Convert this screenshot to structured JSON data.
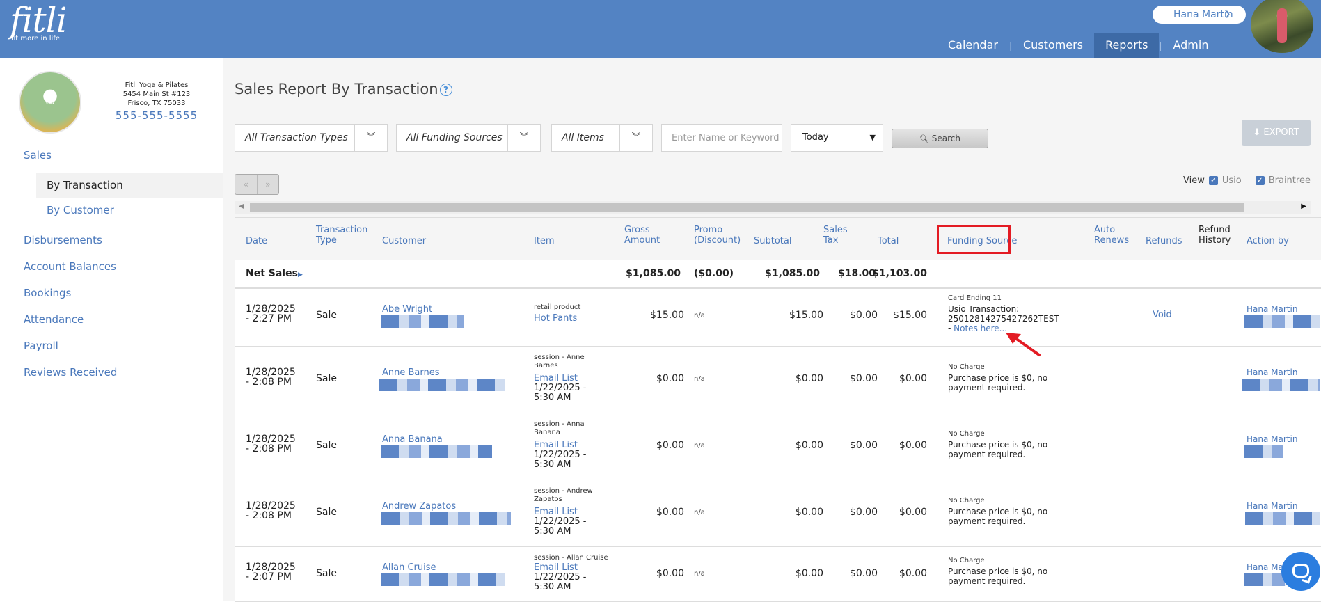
{
  "app": {
    "logo": "fitli",
    "tagline": "fit more in life"
  },
  "header": {
    "user_name": "Hana Martin",
    "nav": [
      "Calendar",
      "Customers",
      "Reports",
      "Admin"
    ],
    "active_nav": "Reports"
  },
  "studio": {
    "name": "Fitli Yoga & Pilates",
    "address1": "5454 Main St #123",
    "address2": "Frisco, TX 75033",
    "phone": "555-555-5555"
  },
  "sidebar": {
    "sales": "Sales",
    "sub": [
      "By Transaction",
      "By Customer"
    ],
    "items": [
      "Disbursements",
      "Account Balances",
      "Bookings",
      "Attendance",
      "Payroll",
      "Reviews Received"
    ]
  },
  "page": {
    "title": "Sales Report By Transaction"
  },
  "filters": {
    "transaction_types": "All Transaction Types",
    "funding_sources": "All Funding Sources",
    "items": "All Items",
    "keyword_placeholder": "Enter Name or Keyword",
    "date_range": "Today",
    "search_label": "Search",
    "export_label": "EXPORT"
  },
  "pager": {
    "prev": "«",
    "next": "»"
  },
  "view": {
    "label": "View",
    "option1": "Usio",
    "option2": "Braintree"
  },
  "table": {
    "headers": {
      "date": "Date",
      "type1": "Transaction",
      "type2": "Type",
      "customer": "Customer",
      "item": "Item",
      "gross1": "Gross",
      "gross2": "Amount",
      "promo1": "Promo",
      "promo2": "(Discount)",
      "subtotal": "Subtotal",
      "tax1": "Sales",
      "tax2": "Tax",
      "total": "Total",
      "funding": "Funding Source",
      "auto1": "Auto",
      "auto2": "Renews",
      "refunds": "Refunds",
      "refhist1": "Refund",
      "refhist2": "History",
      "action": "Action by"
    },
    "net": {
      "label": "Net Sales",
      "gross": "$1,085.00",
      "promo": "($0.00)",
      "subtotal": "$1,085.00",
      "tax": "$18.00",
      "total": "$1,103.00"
    },
    "rows": [
      {
        "date1": "1/28/2025",
        "date2": "- 2:27 PM",
        "type": "Sale",
        "customer": "Abe Wright",
        "item_kind": "retail product",
        "item_kind2": "",
        "item_link": "Hot Pants",
        "item_date1": "",
        "item_date2": "",
        "gross": "$15.00",
        "promo": "n/a",
        "subtotal": "$15.00",
        "tax": "$0.00",
        "total": "$15.00",
        "fund_small": "Card Ending 11",
        "fund_line1": "Usio Transaction:",
        "fund_line2": "25012814275427262TEST",
        "fund_notes": "Notes here...",
        "refund": "Void",
        "action": "Hana Martin"
      },
      {
        "date1": "1/28/2025",
        "date2": "- 2:08 PM",
        "type": "Sale",
        "customer": "Anne Barnes",
        "item_kind": "session - Anne",
        "item_kind2": "Barnes",
        "item_link": "Email List",
        "item_date1": "1/22/2025 -",
        "item_date2": "5:30 AM",
        "gross": "$0.00",
        "promo": "n/a",
        "subtotal": "$0.00",
        "tax": "$0.00",
        "total": "$0.00",
        "fund_small": "No Charge",
        "fund_line1": "Purchase price is $0, no",
        "fund_line2": "payment required.",
        "fund_notes": "",
        "refund": "",
        "action": "Hana Martin"
      },
      {
        "date1": "1/28/2025",
        "date2": "- 2:08 PM",
        "type": "Sale",
        "customer": "Anna Banana",
        "item_kind": "session - Anna",
        "item_kind2": "Banana",
        "item_link": "Email List",
        "item_date1": "1/22/2025 -",
        "item_date2": "5:30 AM",
        "gross": "$0.00",
        "promo": "n/a",
        "subtotal": "$0.00",
        "tax": "$0.00",
        "total": "$0.00",
        "fund_small": "No Charge",
        "fund_line1": "Purchase price is $0, no",
        "fund_line2": "payment required.",
        "fund_notes": "",
        "refund": "",
        "action": "Hana Martin"
      },
      {
        "date1": "1/28/2025",
        "date2": "- 2:08 PM",
        "type": "Sale",
        "customer": "Andrew Zapatos",
        "item_kind": "session - Andrew",
        "item_kind2": "Zapatos",
        "item_link": "Email List",
        "item_date1": "1/22/2025 -",
        "item_date2": "5:30 AM",
        "gross": "$0.00",
        "promo": "n/a",
        "subtotal": "$0.00",
        "tax": "$0.00",
        "total": "$0.00",
        "fund_small": "No Charge",
        "fund_line1": "Purchase price is $0, no",
        "fund_line2": "payment required.",
        "fund_notes": "",
        "refund": "",
        "action": "Hana Martin"
      },
      {
        "date1": "1/28/2025",
        "date2": "- 2:07 PM",
        "type": "Sale",
        "customer": "Allan Cruise",
        "item_kind": "session - Allan Cruise",
        "item_kind2": "",
        "item_link": "Email List",
        "item_date1": "1/22/2025 -",
        "item_date2": "5:30 AM",
        "gross": "$0.00",
        "promo": "n/a",
        "subtotal": "$0.00",
        "tax": "$0.00",
        "total": "$0.00",
        "fund_small": "No Charge",
        "fund_line1": "Purchase price is $0, no",
        "fund_line2": "payment required.",
        "fund_notes": "",
        "refund": "",
        "action": "Hana Ma"
      }
    ]
  }
}
